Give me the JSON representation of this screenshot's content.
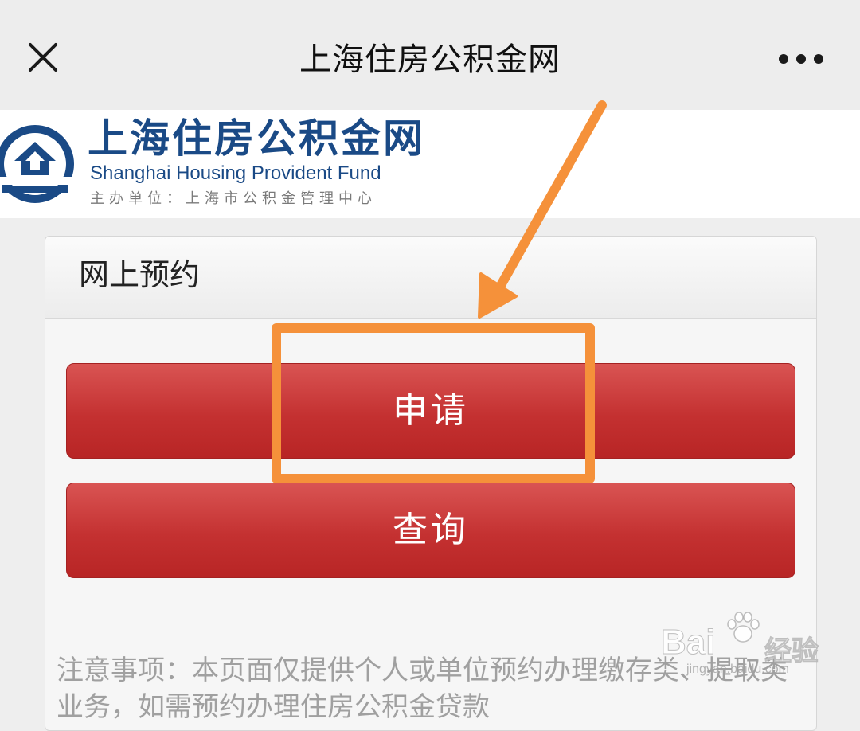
{
  "titlebar": {
    "title": "上海住房公积金网",
    "close_icon": "close-icon",
    "more_icon": "more-horizontal-icon"
  },
  "banner": {
    "logo_icon": "house-circle-logo",
    "name_cn": "上海住房公积金网",
    "name_en": "Shanghai Housing Provident Fund",
    "sponsor": "主办单位：上海市公积金管理中心",
    "brand_color": "#1a4a86"
  },
  "panel": {
    "title": "网上预约",
    "apply_label": "申请",
    "query_label": "查询",
    "notice": "注意事项：本页面仅提供个人或单位预约办理缴存类、提取类业务，如需预约办理住房公积金贷款",
    "button_color": "#c43131"
  },
  "annotation": {
    "color": "#f5913a",
    "arrow_icon": "arrow-down-left-icon",
    "highlight": "apply-button"
  },
  "watermark": {
    "brand": "Bai",
    "brand_suffix": "经验",
    "url": "jingyan.baidu.com",
    "paw_icon": "paw-icon"
  }
}
